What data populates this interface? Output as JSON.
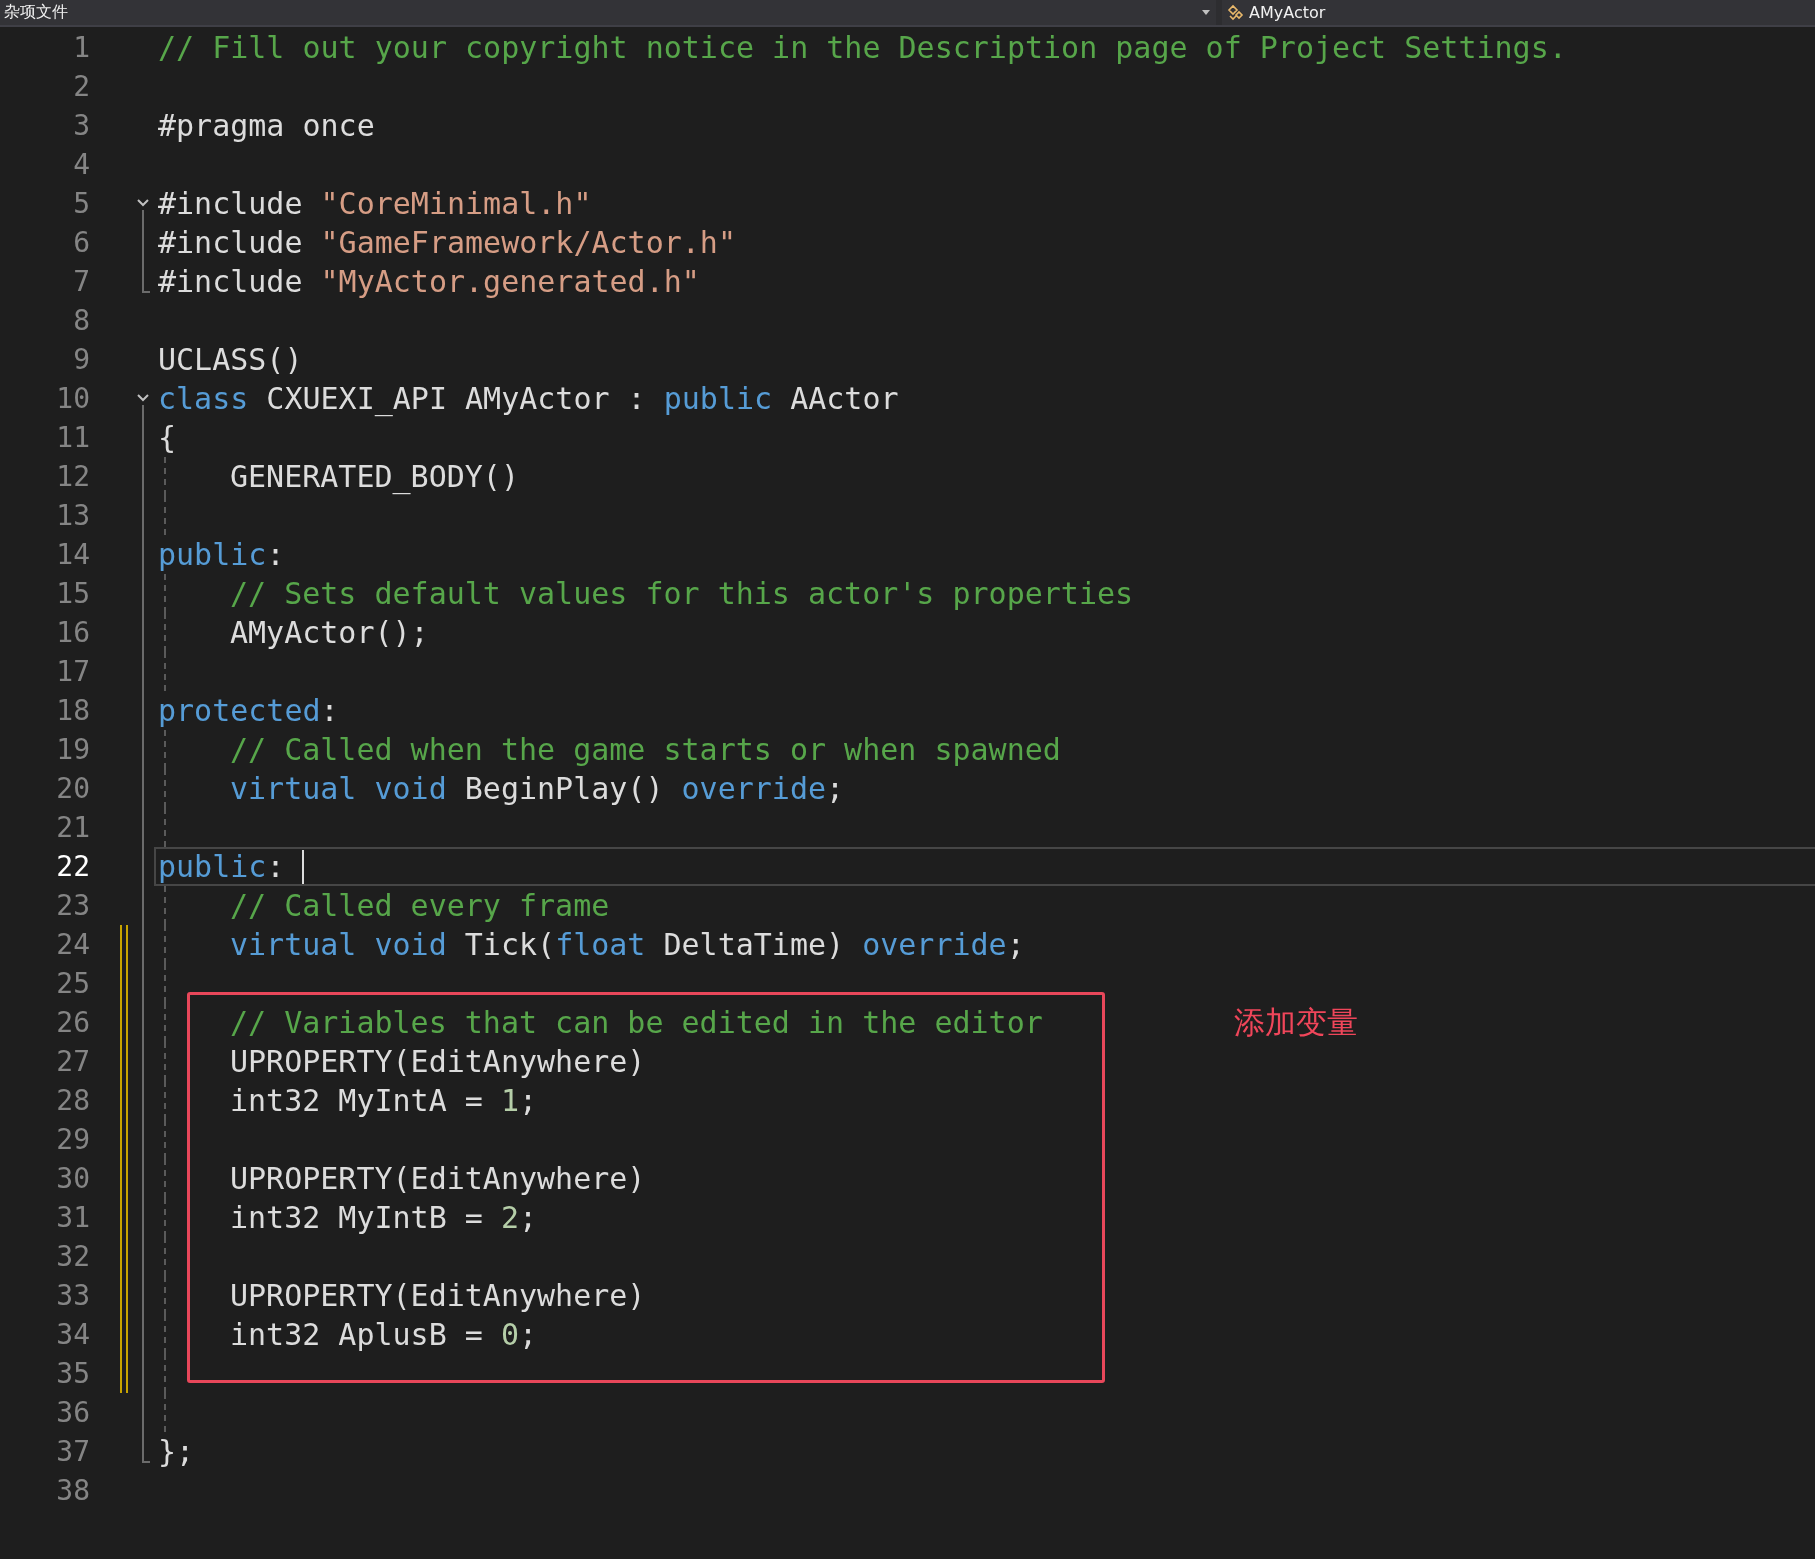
{
  "top_bar": {
    "file_dropdown": {
      "label": "杂项文件"
    },
    "member_dropdown": {
      "label": "AMyActor"
    }
  },
  "lines": [
    {
      "kind": "line",
      "number": "1",
      "tokens": [
        {
          "kind": "comment",
          "text": "// Fill out your copyright notice in the Description page of Project Settings."
        }
      ]
    },
    {
      "kind": "line",
      "number": "2"
    },
    {
      "kind": "line",
      "number": "3",
      "tokens": [
        {
          "kind": "text",
          "text": "#pragma once"
        }
      ]
    },
    {
      "kind": "line",
      "number": "4"
    },
    {
      "kind": "line",
      "number": "5",
      "fold": {
        "expanded": true
      },
      "tokens": [
        {
          "kind": "text",
          "text": "#include "
        },
        {
          "kind": "string",
          "text": "\"CoreMinimal.h\""
        }
      ]
    },
    {
      "kind": "line",
      "number": "6",
      "tokens": [
        {
          "kind": "text",
          "text": "#include "
        },
        {
          "kind": "string",
          "text": "\"GameFramework/Actor.h\""
        }
      ]
    },
    {
      "kind": "line",
      "number": "7",
      "fold_end": true,
      "tokens": [
        {
          "kind": "text",
          "text": "#include "
        },
        {
          "kind": "string",
          "text": "\"MyActor.generated.h\""
        }
      ]
    },
    {
      "kind": "line",
      "number": "8"
    },
    {
      "kind": "line",
      "number": "9",
      "tokens": [
        {
          "kind": "text",
          "text": "UCLASS()"
        }
      ]
    },
    {
      "kind": "line",
      "number": "10",
      "fold": {
        "expanded": true
      },
      "tokens": [
        {
          "kind": "keyword",
          "text": "class"
        },
        {
          "kind": "text",
          "text": " CXUEXI_API AMyActor : "
        },
        {
          "kind": "keyword",
          "text": "public"
        },
        {
          "kind": "text",
          "text": " AActor"
        }
      ]
    },
    {
      "kind": "line",
      "number": "11",
      "tokens": [
        {
          "kind": "text",
          "text": "{"
        }
      ]
    },
    {
      "kind": "line",
      "number": "12",
      "indented": true,
      "tokens": [
        {
          "kind": "text",
          "text": "GENERATED_BODY()"
        }
      ]
    },
    {
      "kind": "line",
      "number": "13",
      "indented": true
    },
    {
      "kind": "line",
      "number": "14",
      "tokens": [
        {
          "kind": "keyword",
          "text": "public"
        },
        {
          "kind": "text",
          "text": ":"
        }
      ]
    },
    {
      "kind": "line",
      "number": "15",
      "indented": true,
      "tokens": [
        {
          "kind": "comment",
          "text": "// Sets default values for this actor's properties"
        }
      ]
    },
    {
      "kind": "line",
      "number": "16",
      "indented": true,
      "tokens": [
        {
          "kind": "text",
          "text": "AMyActor();"
        }
      ]
    },
    {
      "kind": "line",
      "number": "17",
      "indented": true
    },
    {
      "kind": "line",
      "number": "18",
      "tokens": [
        {
          "kind": "keyword",
          "text": "protected"
        },
        {
          "kind": "text",
          "text": ":"
        }
      ]
    },
    {
      "kind": "line",
      "number": "19",
      "indented": true,
      "tokens": [
        {
          "kind": "comment",
          "text": "// Called when the game starts or when spawned"
        }
      ]
    },
    {
      "kind": "line",
      "number": "20",
      "indented": true,
      "tokens": [
        {
          "kind": "keyword",
          "text": "virtual void"
        },
        {
          "kind": "text",
          "text": " BeginPlay() "
        },
        {
          "kind": "keyword",
          "text": "override"
        },
        {
          "kind": "text",
          "text": ";"
        }
      ]
    },
    {
      "kind": "line",
      "number": "21",
      "indented": true
    },
    {
      "kind": "line",
      "number": "22",
      "selected": true,
      "tokens": [
        {
          "kind": "keyword",
          "text": "public"
        },
        {
          "kind": "text",
          "text": ":"
        }
      ]
    },
    {
      "kind": "line",
      "number": "23",
      "indented": true,
      "tokens": [
        {
          "kind": "comment",
          "text": "// Called every frame"
        }
      ]
    },
    {
      "kind": "line",
      "number": "24",
      "indented": true,
      "changed": true,
      "tokens": [
        {
          "kind": "keyword",
          "text": "virtual void"
        },
        {
          "kind": "text",
          "text": " Tick("
        },
        {
          "kind": "keyword",
          "text": "float"
        },
        {
          "kind": "text",
          "text": " DeltaTime) "
        },
        {
          "kind": "keyword",
          "text": "override"
        },
        {
          "kind": "text",
          "text": ";"
        }
      ]
    },
    {
      "kind": "line",
      "number": "25",
      "indented": true,
      "changed": true
    },
    {
      "kind": "annotation_box",
      "note": "添加变量",
      "lines": [
        {
          "number": "26",
          "indented": true,
          "changed": true,
          "tokens": [
            {
              "kind": "comment",
              "text": "// Variables that can be edited in the editor"
            }
          ]
        },
        {
          "number": "27",
          "indented": true,
          "changed": true,
          "tokens": [
            {
              "kind": "text",
              "text": "UPROPERTY(EditAnywhere)"
            }
          ]
        },
        {
          "number": "28",
          "indented": true,
          "changed": true,
          "tokens": [
            {
              "kind": "text",
              "text": "int32 MyIntA = "
            },
            {
              "kind": "number",
              "text": "1"
            },
            {
              "kind": "text",
              "text": ";"
            }
          ]
        },
        {
          "number": "29",
          "indented": true,
          "changed": true
        },
        {
          "number": "30",
          "indented": true,
          "changed": true,
          "tokens": [
            {
              "kind": "text",
              "text": "UPROPERTY(EditAnywhere)"
            }
          ]
        },
        {
          "number": "31",
          "indented": true,
          "changed": true,
          "tokens": [
            {
              "kind": "text",
              "text": "int32 MyIntB = "
            },
            {
              "kind": "number",
              "text": "2"
            },
            {
              "kind": "text",
              "text": ";"
            }
          ]
        },
        {
          "number": "32",
          "indented": true,
          "changed": true
        },
        {
          "number": "33",
          "indented": true,
          "changed": true,
          "tokens": [
            {
              "kind": "text",
              "text": "UPROPERTY(EditAnywhere)"
            }
          ]
        },
        {
          "number": "34",
          "indented": true,
          "changed": true,
          "tokens": [
            {
              "kind": "text",
              "text": "int32 AplusB = "
            },
            {
              "kind": "number",
              "text": "0"
            },
            {
              "kind": "text",
              "text": ";"
            }
          ]
        },
        {
          "number": "35",
          "indented": true,
          "changed": true
        }
      ]
    },
    {
      "kind": "line",
      "number": "36",
      "indented": true
    },
    {
      "kind": "line",
      "number": "37",
      "fold_end": true,
      "tokens": [
        {
          "kind": "text",
          "text": "};"
        }
      ]
    },
    {
      "kind": "line",
      "number": "38"
    }
  ]
}
